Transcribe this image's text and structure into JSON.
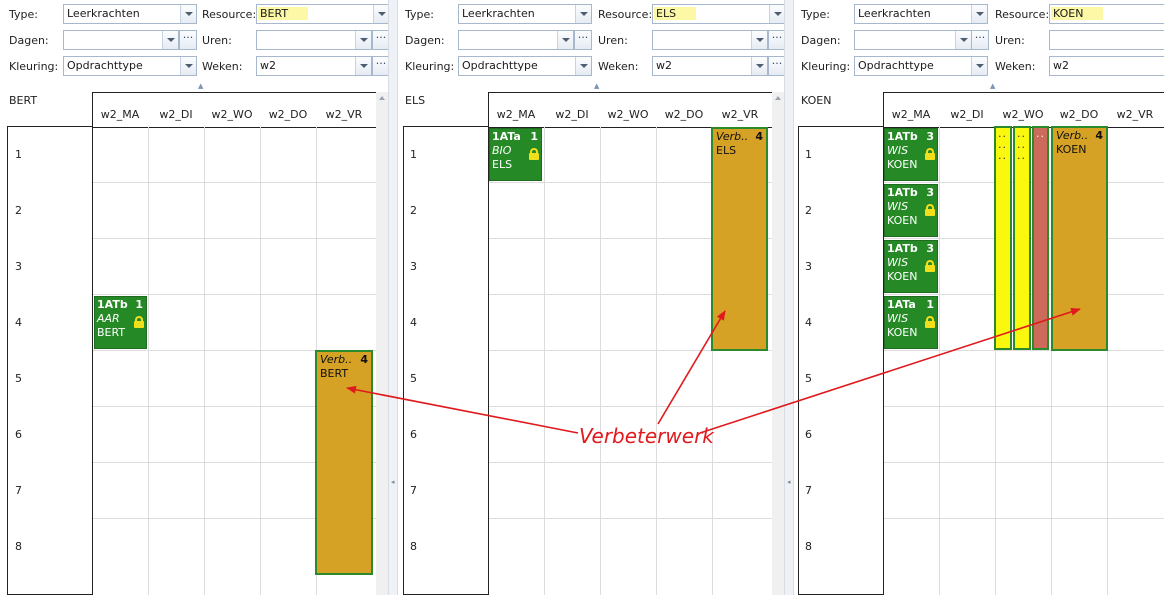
{
  "labels": {
    "type": "Type:",
    "resource": "Resource:",
    "dagen": "Dagen:",
    "uren": "Uren:",
    "kleuring": "Kleuring:",
    "weken": "Weken:",
    "ellipsis": "···"
  },
  "day_headers": [
    "w2_MA",
    "w2_DI",
    "w2_WO",
    "w2_DO",
    "w2_VR"
  ],
  "hours": [
    "1",
    "2",
    "3",
    "4",
    "5",
    "6",
    "7",
    "8"
  ],
  "panes": [
    {
      "type_value": "Leerkrachten",
      "resource_value": "BERT",
      "dagen_value": "",
      "uren_value": "",
      "kleuring_value": "Opdrachttype",
      "weken_value": "w2",
      "resource_name": "BERT",
      "lessons": [
        {
          "class": "1ATb",
          "count": "1",
          "subject": "AAR",
          "teacher": "BERT"
        }
      ],
      "verbeterwerk": {
        "title": "Verb..",
        "count": "4",
        "teacher": "BERT"
      }
    },
    {
      "type_value": "Leerkrachten",
      "resource_value": "ELS",
      "dagen_value": "",
      "uren_value": "",
      "kleuring_value": "Opdrachttype",
      "weken_value": "w2",
      "resource_name": "ELS",
      "lessons": [
        {
          "class": "1ATa",
          "count": "1",
          "subject": "BIO",
          "teacher": "ELS"
        }
      ],
      "verbeterwerk": {
        "title": "Verb..",
        "count": "4",
        "teacher": "ELS"
      }
    },
    {
      "type_value": "Leerkrachten",
      "resource_value": "KOEN",
      "dagen_value": "",
      "uren_value": "",
      "kleuring_value": "Opdrachttype",
      "weken_value": "w2",
      "resource_name": "KOEN",
      "lessons": [
        {
          "class": "1ATb",
          "count": "3",
          "subject": "WIS",
          "teacher": "KOEN"
        },
        {
          "class": "1ATb",
          "count": "3",
          "subject": "WIS",
          "teacher": "KOEN"
        },
        {
          "class": "1ATb",
          "count": "3",
          "subject": "WIS",
          "teacher": "KOEN"
        },
        {
          "class": "1ATa",
          "count": "1",
          "subject": "WIS",
          "teacher": "KOEN"
        }
      ],
      "strips": [
        {
          "text": ".. .. .."
        },
        {
          "text": ".. .. .."
        },
        {
          "text": ".."
        }
      ],
      "verbeterwerk": {
        "title": "Verb..",
        "count": "4",
        "teacher": "KOEN"
      }
    }
  ],
  "annotation": {
    "label": "Verbeterwerk",
    "color": "#e0191d"
  },
  "colors": {
    "lesson_green": "#258a25",
    "verbeterwerk": "#d6a225",
    "highlight_yellow": "#fbf80f",
    "conflict_red": "#cc6b5a",
    "resource_highlight": "#fdf8a6"
  }
}
